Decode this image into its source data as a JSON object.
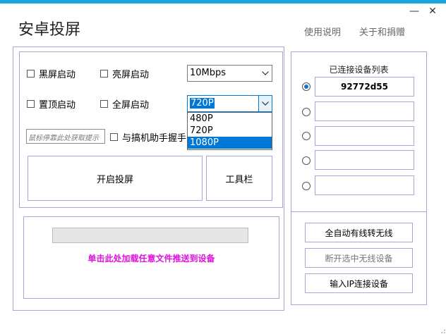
{
  "window": {
    "title": "安卓投屏",
    "close_glyph": "✕",
    "minimize_glyph": "—",
    "accent_color": "#1ba7d9"
  },
  "header": {
    "help_link": "使用说明",
    "about_link": "关于和捐赠"
  },
  "options": {
    "black_screen": "黑屏启动",
    "bright_screen": "亮屏启动",
    "on_top": "置顶启动",
    "fullscreen": "全屏启动",
    "handshake": "与搞机助手握手"
  },
  "bitrate_select": {
    "value": "10Mbps"
  },
  "resolution_select": {
    "value": "720P",
    "options": [
      "480P",
      "720P",
      "1080P"
    ],
    "highlighted": "1080P"
  },
  "hint_field": {
    "placeholder": "鼠标停靠此处获取提示"
  },
  "buttons": {
    "start_mirror": "开启投屏",
    "toolbar": "工具栏"
  },
  "push": {
    "label": "单击此处加载任意文件推送到设备",
    "progress": 0,
    "label_color": "#e010e0"
  },
  "devices": {
    "title": "已连接设备列表",
    "slots": [
      "92772d55",
      "",
      "",
      "",
      ""
    ],
    "selected_index": 0
  },
  "right_buttons": {
    "auto_wireless": "全自动有线转无线",
    "disconnect_wireless": "断开选中无线设备",
    "ip_connect": "输入IP连接设备"
  }
}
